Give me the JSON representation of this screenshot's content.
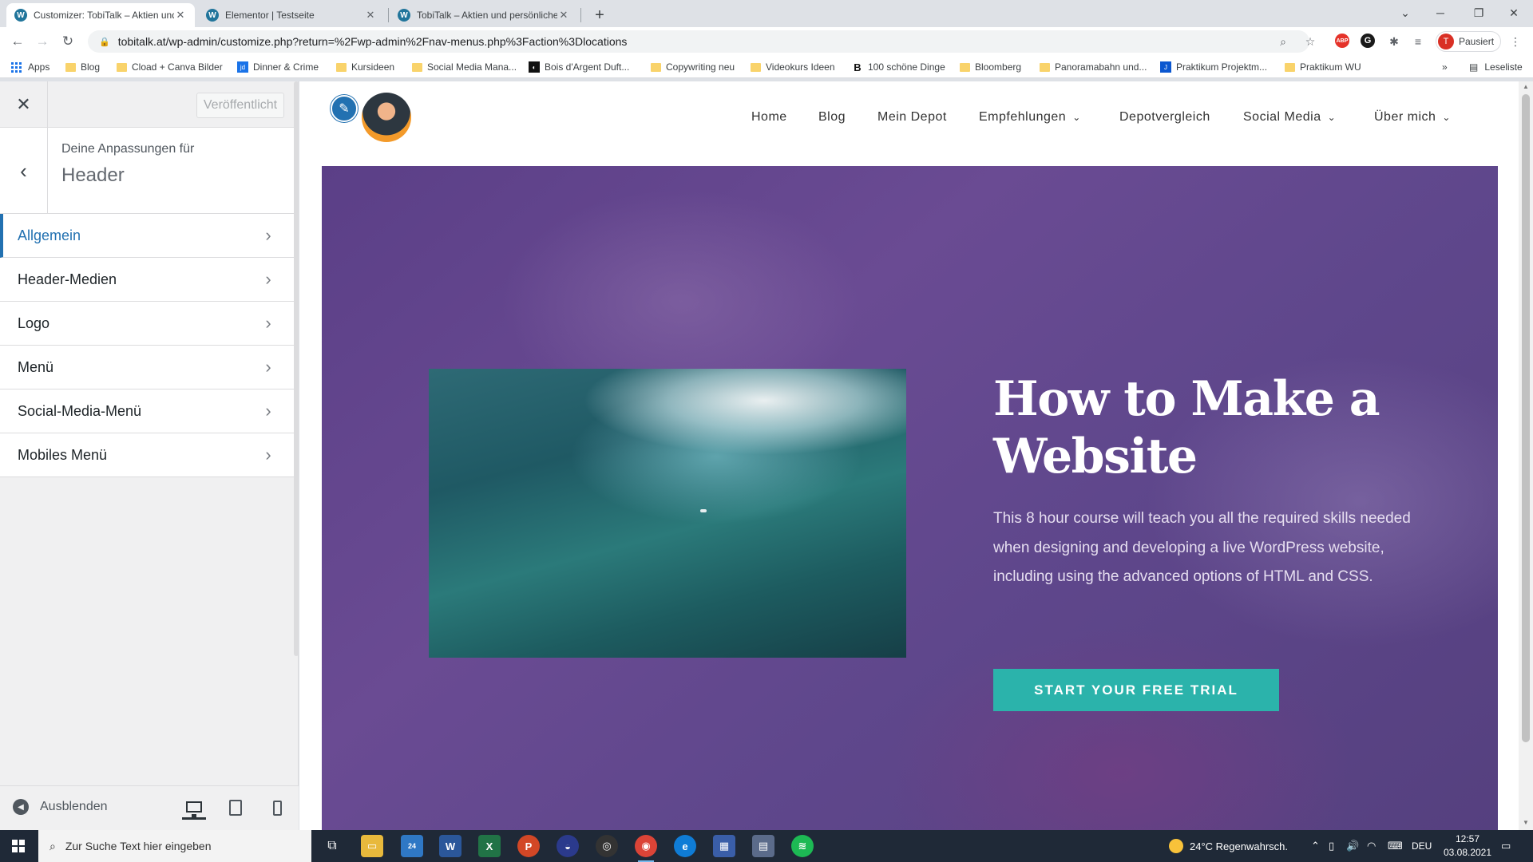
{
  "browser": {
    "tabs": [
      {
        "title": "Customizer: TobiTalk – Aktien und",
        "active": true
      },
      {
        "title": "Elementor | Testseite",
        "active": false
      },
      {
        "title": "TobiTalk – Aktien und persönliche",
        "active": false
      }
    ],
    "address": "tobitalk.at/wp-admin/customize.php?return=%2Fwp-admin%2Fnav-menus.php%3Faction%3Dlocations",
    "profile_label": "Pausiert",
    "profile_initial": "T",
    "bookmarks": [
      {
        "label": "Apps",
        "icon": "apps-grid-icon"
      },
      {
        "label": "Blog",
        "icon": "folder-icon"
      },
      {
        "label": "Cload + Canva Bilder",
        "icon": "folder-icon"
      },
      {
        "label": "Dinner & Crime",
        "icon": "jd-icon"
      },
      {
        "label": "Kursideen",
        "icon": "folder-icon"
      },
      {
        "label": "Social Media Mana...",
        "icon": "folder-icon"
      },
      {
        "label": "Bois d'Argent Duft...",
        "icon": "dark-site-icon"
      },
      {
        "label": "Copywriting neu",
        "icon": "folder-icon"
      },
      {
        "label": "Videokurs Ideen",
        "icon": "folder-icon"
      },
      {
        "label": "100 schöne Dinge",
        "icon": "b-site-icon"
      },
      {
        "label": "Bloomberg",
        "icon": "folder-icon"
      },
      {
        "label": "Panoramabahn und...",
        "icon": "folder-icon"
      },
      {
        "label": "Praktikum Projektm...",
        "icon": "j-site-icon"
      },
      {
        "label": "Praktikum WU",
        "icon": "folder-icon"
      }
    ],
    "reading_list": "Leseliste",
    "more_bookmarks": "»"
  },
  "customizer": {
    "publish_label": "Veröffentlicht",
    "section_subtitle": "Deine Anpassungen für",
    "section_title": "Header",
    "items": [
      {
        "label": "Allgemein",
        "active": true
      },
      {
        "label": "Header-Medien",
        "active": false
      },
      {
        "label": "Logo",
        "active": false
      },
      {
        "label": "Menü",
        "active": false
      },
      {
        "label": "Social-Media-Menü",
        "active": false
      },
      {
        "label": "Mobiles Menü",
        "active": false
      }
    ],
    "hide_label": "Ausblenden",
    "accent_color": "#2271b1"
  },
  "site": {
    "nav": [
      {
        "label": "Home",
        "dropdown": false
      },
      {
        "label": "Blog",
        "dropdown": false
      },
      {
        "label": "Mein Depot",
        "dropdown": false
      },
      {
        "label": "Empfehlungen",
        "dropdown": true
      },
      {
        "label": "Depotvergleich",
        "dropdown": false
      },
      {
        "label": "Social Media",
        "dropdown": true
      },
      {
        "label": "Über mich",
        "dropdown": true
      }
    ],
    "hero": {
      "title": "How to Make a Website",
      "text": "This 8 hour course will teach you all the required skills needed when designing and developing a live WordPress website, including using the advanced options of HTML and CSS.",
      "cta": "START YOUR FREE TRIAL",
      "cta_color": "#2bb3ab"
    }
  },
  "taskbar": {
    "search_placeholder": "Zur Suche Text hier eingeben",
    "mail_badge": "24",
    "weather": "24°C  Regenwahrsch.",
    "language": "DEU",
    "time": "12:57",
    "date": "03.08.2021"
  }
}
